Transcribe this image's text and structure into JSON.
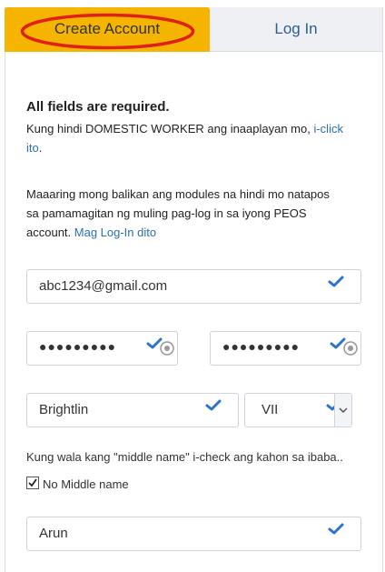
{
  "tabs": {
    "create_account": "Create Account",
    "log_in": "Log In"
  },
  "form": {
    "heading": "All fields are required.",
    "intro_line1": "Kung hindi DOMESTIC WORKER ang inaaplayan mo, ",
    "intro_link_part1": "i-click",
    "intro_link_part2": "ito",
    "intro_period": ".",
    "resume_text_line1": "Maaaring mong balikan ang modules na hindi mo natapos",
    "resume_text_line2": "sa pamamagitan ng muling pag-log in sa iyong PEOS",
    "resume_text_line3": "account. ",
    "login_link": "Mag Log-In dito",
    "email_value": "abc1234@gmail.com",
    "password_value": "●●●●●●●●●",
    "confirm_password_value": "●●●●●●●●●",
    "first_name_value": "Brightlin",
    "suffix_value": "VII",
    "middle_name_note": "Kung wala kang \"middle name\" i-check ang kahon sa ibaba..",
    "no_middle_name_label": "No Middle name",
    "no_middle_name_checked": true,
    "last_name_value": "Arun"
  },
  "colors": {
    "accent": "#f4b400",
    "link": "#2a6fb8",
    "check": "#2a75c9",
    "annotation_ellipse": "#e0201b"
  }
}
